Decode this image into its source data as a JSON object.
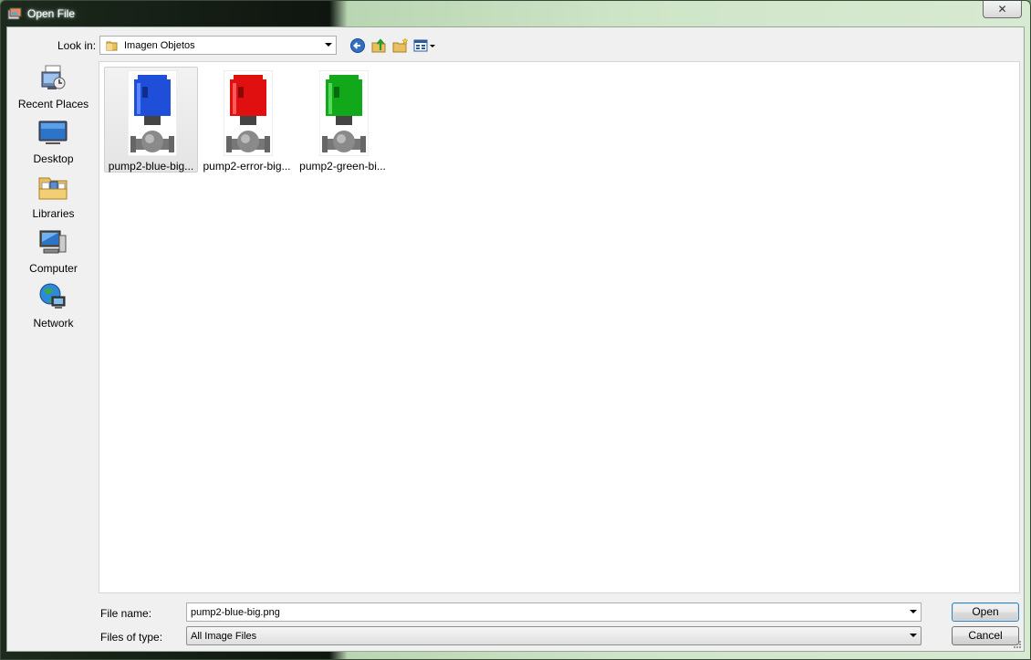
{
  "window": {
    "title": "Open File",
    "close_glyph": "✕"
  },
  "lookin": {
    "label": "Look in:",
    "value": "Imagen Objetos"
  },
  "toolbar": {
    "back_icon": "back-arrow-icon",
    "up_icon": "up-folder-icon",
    "new_icon": "new-folder-icon",
    "view_icon": "view-menu-icon"
  },
  "places": [
    {
      "label": "Recent Places",
      "icon": "recent-places-icon"
    },
    {
      "label": "Desktop",
      "icon": "desktop-icon"
    },
    {
      "label": "Libraries",
      "icon": "libraries-icon"
    },
    {
      "label": "Computer",
      "icon": "computer-icon"
    },
    {
      "label": "Network",
      "icon": "network-icon"
    }
  ],
  "files": [
    {
      "name": "pump2-blue-big...",
      "color": "#1f4fd8",
      "selected": true
    },
    {
      "name": "pump2-error-big...",
      "color": "#e01010",
      "selected": false
    },
    {
      "name": "pump2-green-bi...",
      "color": "#11a81a",
      "selected": false
    }
  ],
  "filename": {
    "label": "File name:",
    "value": "pump2-blue-big.png"
  },
  "filetype": {
    "label": "Files of type:",
    "value": "All Image Files"
  },
  "buttons": {
    "open": "Open",
    "cancel": "Cancel"
  }
}
